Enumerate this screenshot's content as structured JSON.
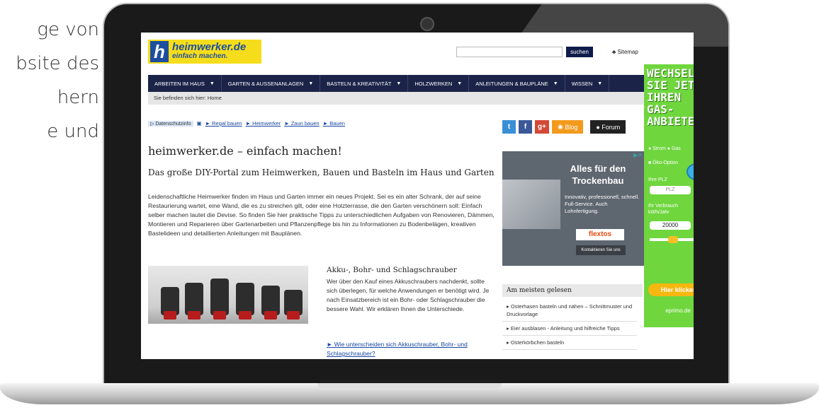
{
  "slide_text": [
    "ge von",
    "bsite des",
    "hern",
    "e und"
  ],
  "site": {
    "logo_letter": "h",
    "logo_name": "heimwerker.de",
    "logo_tagline": "einfach machen.",
    "search_button": "suchen",
    "sitemap": "Sitemap",
    "nav": [
      "ARBEITEN IM HAUS",
      "GARTEN & AUSSENANLAGEN",
      "BASTELN & KREATIVITÄT",
      "HOLZWERKEN",
      "ANLEITUNGEN & BAUPLÄNE",
      "WISSEN"
    ],
    "breadcrumb": "Sie befinden sich hier: Home",
    "privacy_label": "Datenschutzinfo",
    "quick_links": [
      "► Regal bauen",
      "► Heimwerker",
      "► Zaun bauen",
      "► Bauen"
    ],
    "title": "heimwerker.de – einfach machen!",
    "subtitle": "Das große DIY-Portal zum Heimwerken, Bauen und Basteln im Haus und Garten",
    "intro": "Leidenschaftliche Heimwerker finden im Haus und Garten immer ein neues Projekt. Sei es ein alter Schrank, der auf seine Restaurierung wartet, eine Wand, die es zu streichen gilt, oder eine Holzterrasse, die den Garten verschönern soll: Einfach selber machen lautet die Devise. So finden Sie hier praktische Tipps zu unterschiedlichen Aufgaben von Renovieren, Dämmen, Montieren und Reparieren über Gartenarbeiten und Pflanzenpflege bis hin zu Informationen zu Bodenbelägen, kreativen Bastelideen und detaillierten Anleitungen mit Bauplänen.",
    "card_title": "Akku-, Bohr- und Schlagschrauber",
    "card_body": "Wer über den Kauf eines Akkuschraubers nachdenkt, sollte sich überlegen, für welche Anwendungen er benötigt wird. Je nach Einsatzbereich ist ein Bohr- oder Schlagschrauber die bessere Wahl. Wir erklären Ihnen die Unterschiede.",
    "card_link": "► Wie unterscheiden sich Akkuschrauber, Bohr- und Schlagschrauber?",
    "social_blog": "Blog",
    "social_forum": "Forum",
    "ad": {
      "headline": "Alles für den Trockenbau",
      "text": "Innovativ, professionell, schnell. Full-Service. Auch Lohnfertigung.",
      "brand": "flextos",
      "button": "Kontaktieren Sie uns"
    },
    "most_read_title": "Am meisten gelesen",
    "most_read": [
      "▸ Osterhasen basteln und nähen – Schnittmuster und Druckvorlage",
      "▸ Eier ausblasen - Anleitung und hilfreiche Tipps",
      "▸ Osterkörbchen basteln"
    ],
    "banner": {
      "headline": "WECHSELN SIE JETZT IHREN GAS-ANBIETER!",
      "radio": "● Strom   ● Gas",
      "oko": "■ Öko-Option",
      "plz_label": "Ihre PLZ",
      "plz_placeholder": "PLZ",
      "verbrauch_label": "Ihr Verbrauch kWh/Jahr",
      "verbrauch_value": "20000",
      "cta": "Hier klicken",
      "brand": "eprimo.de"
    }
  }
}
